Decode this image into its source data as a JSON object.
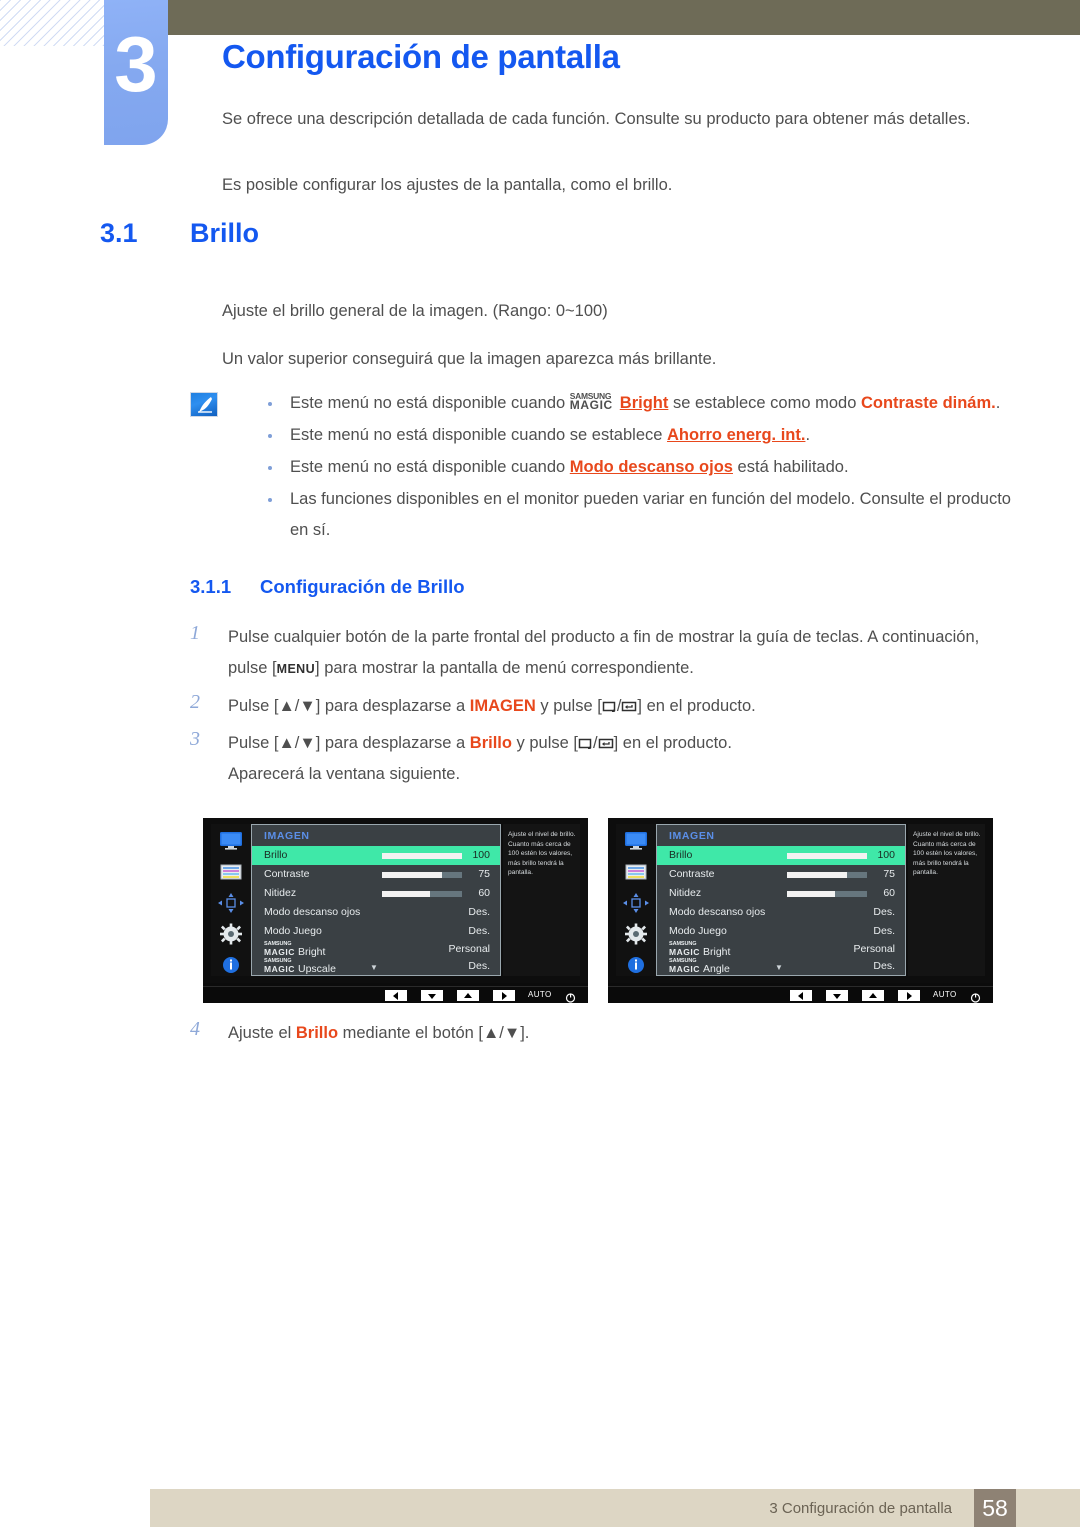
{
  "chapter": {
    "number": "3",
    "title": "Configuración de pantalla",
    "intro_1": "Se ofrece una descripción detallada de cada función. Consulte su producto para obtener más detalles.",
    "intro_2": "Es posible configurar los ajustes de la pantalla, como el brillo."
  },
  "section": {
    "number": "3.1",
    "title": "Brillo",
    "paragraph_1": "Ajuste el brillo general de la imagen. (Rango: 0~100)",
    "paragraph_2": "Un valor superior conseguirá que la imagen aparezca más brillante."
  },
  "note": {
    "icon": "note-pen-icon",
    "bullets": [
      {
        "pre": "Este menú no está disponible cuando ",
        "magic_top": "SAMSUNG",
        "magic_bottom": "MAGIC",
        "magic_suffix": "Bright",
        "mid": " se establece como modo ",
        "emphasis": "Contraste dinám.",
        "post": "."
      },
      {
        "pre": "Este menú no está disponible cuando se establece ",
        "emphasis": "Ahorro energ. int.",
        "post": "."
      },
      {
        "pre": "Este menú no está disponible cuando ",
        "emphasis": "Modo descanso ojos",
        "post": " está habilitado."
      },
      {
        "pre": "Las funciones disponibles en el monitor pueden variar en función del modelo. Consulte el producto en sí.",
        "emphasis": "",
        "post": ""
      }
    ]
  },
  "subsection": {
    "number": "3.1.1",
    "title": "Configuración de Brillo"
  },
  "steps": [
    {
      "num": "1",
      "text_a": "Pulse cualquier botón de la parte frontal del producto a fin de mostrar la guía de teclas. A continuación, pulse [",
      "key": "MENU",
      "text_b": "] para mostrar la pantalla de menú correspondiente."
    },
    {
      "num": "2",
      "text_a": "Pulse [▲/▼] para desplazarse a ",
      "emphasis": "IMAGEN",
      "text_b": " y pulse [",
      "text_c": "] en el producto."
    },
    {
      "num": "3",
      "text_a": "Pulse [▲/▼] para desplazarse a ",
      "emphasis": "Brillo",
      "text_b": " y pulse [",
      "text_c": "] en el producto.",
      "sub": "Aparecerá la ventana siguiente."
    },
    {
      "num": "4",
      "text_a": "Ajuste el ",
      "emphasis": "Brillo",
      "text_b": " mediante el botón [▲/▼]."
    }
  ],
  "osd": {
    "highlight_color": "#3fe8a8",
    "title": "IMAGEN",
    "rail_icons": [
      "monitor-icon",
      "color-bars-icon",
      "move-arrows-icon",
      "gear-icon",
      "info-icon"
    ],
    "tooltip": "Ajuste el nivel de brillo. Cuanto más cerca de 100 estén los valores, más brillo tendrá la pantalla.",
    "caret": "▼",
    "bottom_keys": [
      "left-arrow-key",
      "down-arrow-key",
      "up-arrow-key",
      "right-arrow-key"
    ],
    "auto_label": "AUTO",
    "power_icon": "power-icon",
    "left": {
      "rows": [
        {
          "label": "Brillo",
          "value": "100",
          "bar": 100,
          "highlight": true
        },
        {
          "label": "Contraste",
          "value": "75",
          "bar": 75,
          "highlight": false
        },
        {
          "label": "Nitidez",
          "value": "60",
          "bar": 60,
          "highlight": false
        },
        {
          "label": "Modo descanso ojos",
          "value": "Des.",
          "highlight": false
        },
        {
          "label": "Modo Juego",
          "value": "Des.",
          "highlight": false
        },
        {
          "magic_top": "SAMSUNG",
          "magic_bottom": "MAGIC",
          "suffix": "Bright",
          "value": "Personal",
          "highlight": false
        },
        {
          "magic_top": "SAMSUNG",
          "magic_bottom": "MAGIC",
          "suffix": "Upscale",
          "value": "Des.",
          "highlight": false
        }
      ]
    },
    "right": {
      "rows": [
        {
          "label": "Brillo",
          "value": "100",
          "bar": 100,
          "highlight": true
        },
        {
          "label": "Contraste",
          "value": "75",
          "bar": 75,
          "highlight": false
        },
        {
          "label": "Nitidez",
          "value": "60",
          "bar": 60,
          "highlight": false
        },
        {
          "label": "Modo descanso ojos",
          "value": "Des.",
          "highlight": false
        },
        {
          "label": "Modo Juego",
          "value": "Des.",
          "highlight": false
        },
        {
          "magic_top": "SAMSUNG",
          "magic_bottom": "MAGIC",
          "suffix": "Bright",
          "value": "Personal",
          "highlight": false
        },
        {
          "magic_top": "SAMSUNG",
          "magic_bottom": "MAGIC",
          "suffix": "Angle",
          "value": "Des.",
          "highlight": false
        }
      ]
    }
  },
  "footer": {
    "text": "3 Configuración de pantalla",
    "page": "58"
  }
}
